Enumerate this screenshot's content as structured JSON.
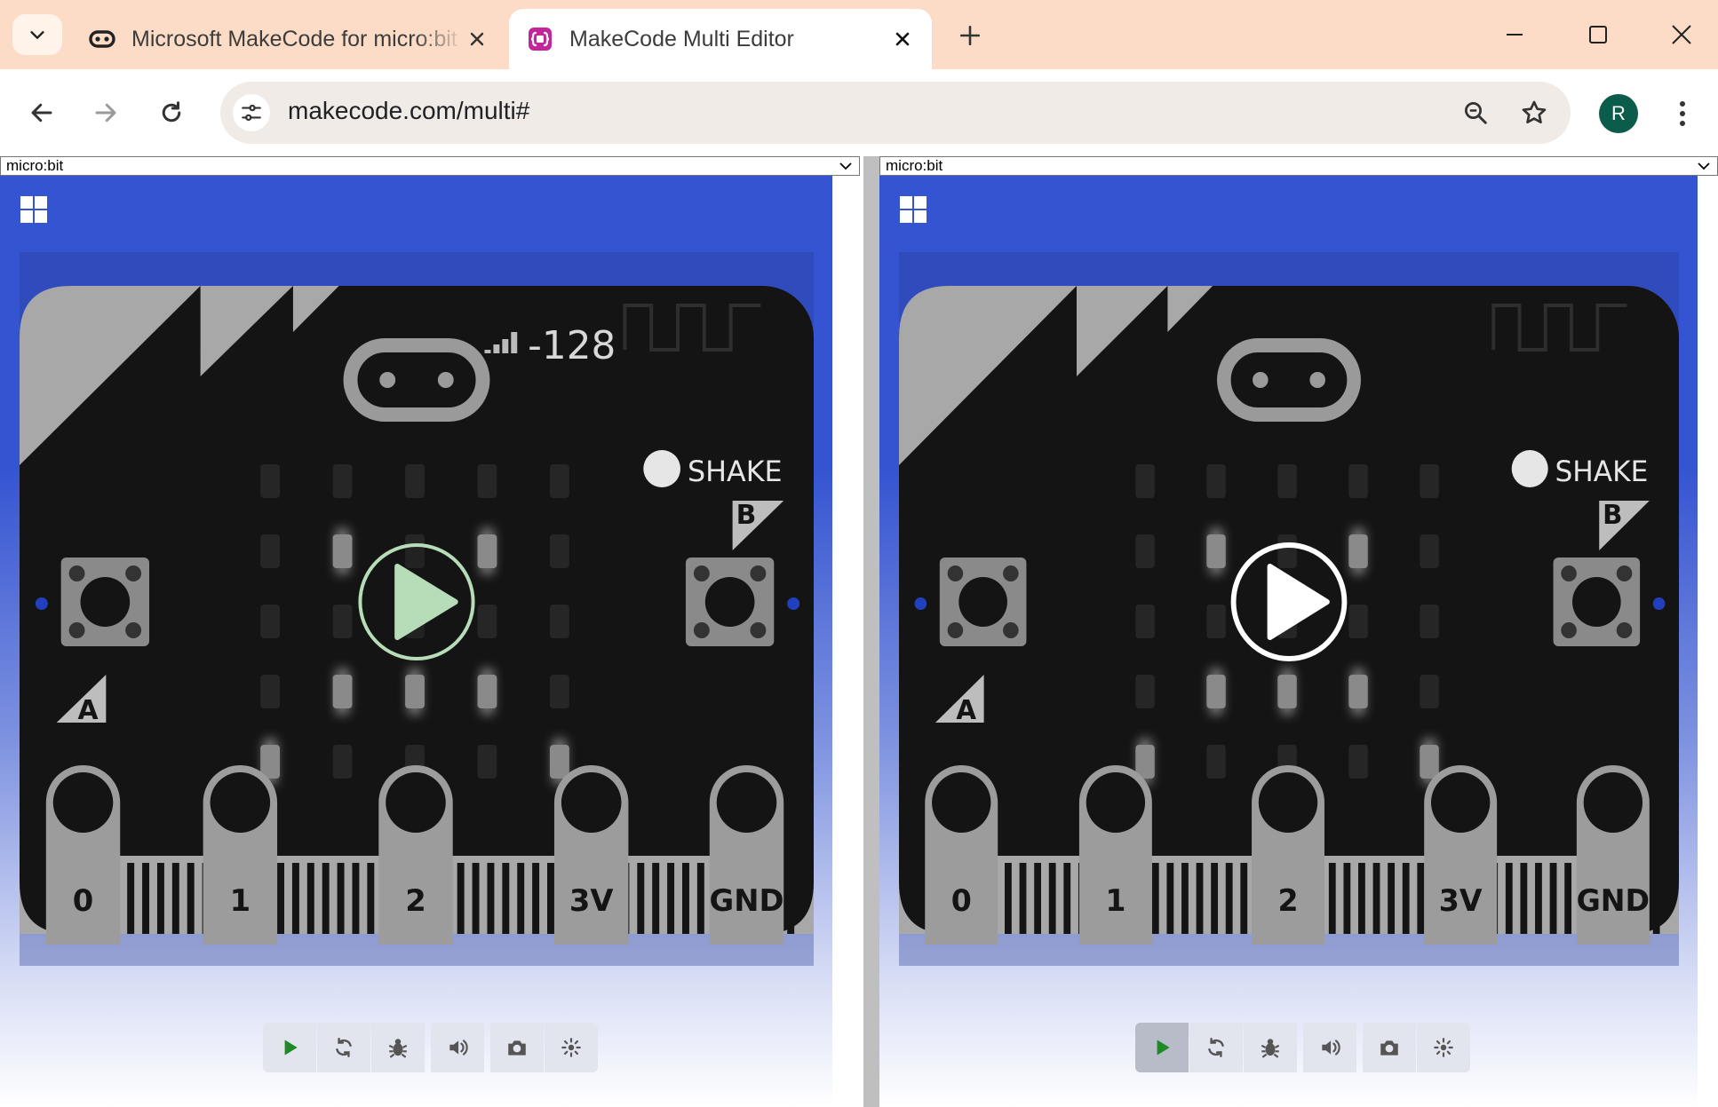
{
  "browser": {
    "tabs": [
      {
        "title": "Microsoft MakeCode for micro:bit",
        "favicon": "microbit-icon"
      },
      {
        "title": "MakeCode Multi Editor",
        "favicon": "makecode-icon",
        "active": true
      }
    ],
    "url": "makecode.com/multi#",
    "profile_initial": "R"
  },
  "panes": [
    {
      "id": "left",
      "target": "micro:bit",
      "radio_signal": "-128",
      "shake_label": "SHAKE",
      "button_a": "A",
      "button_b": "B",
      "pins": [
        "0",
        "1",
        "2",
        "3V",
        "GND"
      ],
      "play_overlay": "faded-green",
      "controls": [
        "play",
        "restart",
        "debug",
        "mute",
        "screenshot",
        "fullscreen"
      ]
    },
    {
      "id": "right",
      "target": "micro:bit",
      "shake_label": "SHAKE",
      "button_a": "A",
      "button_b": "B",
      "pins": [
        "0",
        "1",
        "2",
        "3V",
        "GND"
      ],
      "play_overlay": "white",
      "controls": [
        "play",
        "restart",
        "debug",
        "mute",
        "screenshot",
        "fullscreen"
      ]
    }
  ],
  "led_pattern": [
    [
      0,
      0,
      0,
      0,
      0
    ],
    [
      0,
      1,
      0,
      1,
      0
    ],
    [
      0,
      0,
      0,
      0,
      0
    ],
    [
      0,
      1,
      1,
      1,
      0
    ],
    [
      1,
      0,
      0,
      0,
      1
    ]
  ],
  "colors": {
    "tab_strip": "#fcdcc6",
    "sim_blue": "#3554d1",
    "board": "#141414",
    "board_edge": "#a8a8a8",
    "led_lit": "#8a8a8a",
    "avatar": "#0b5c4b",
    "play_green": "#1e8a25"
  }
}
